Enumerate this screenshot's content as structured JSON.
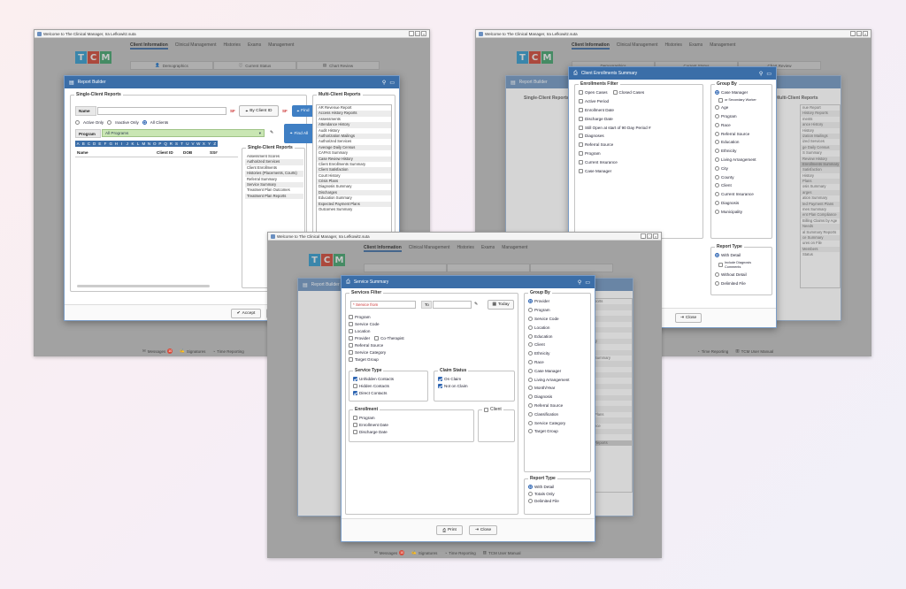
{
  "window_title": "Welcome to The Clinical Manager, Ira Lefkowitz.suta",
  "logo": [
    "T",
    "C",
    "M"
  ],
  "nav": [
    "Client Information",
    "Clinical Management",
    "Histories",
    "Exams",
    "Management"
  ],
  "subtabs": [
    "Demographics",
    "Current Status",
    "Chart Review"
  ],
  "bottom": {
    "messages": "Messages",
    "messages_count": "10",
    "signatures": "Signatures",
    "time_reporting": "Time Reporting",
    "user_manual": "TCM User Manual"
  },
  "report_builder": {
    "title": "Report Builder",
    "single_client": "Single-Client Reports",
    "multi_client": "Multi-Client Reports",
    "name_label": "Name",
    "by_client_id": "By Client ID",
    "find": "Find",
    "find_all": "Find All",
    "sf": "SF",
    "radios": [
      "Active Only",
      "Inactive Only",
      "All Clients"
    ],
    "program_label": "Program",
    "program_value": "All Programs",
    "alpha": [
      "A",
      "B",
      "C",
      "D",
      "E",
      "F",
      "G",
      "H",
      "I",
      "J",
      "K",
      "L",
      "M",
      "N",
      "O",
      "P",
      "Q",
      "R",
      "S",
      "T",
      "U",
      "V",
      "W",
      "X",
      "Y",
      "Z"
    ],
    "columns": [
      "Name",
      "Client ID",
      "DOB",
      "SS#"
    ],
    "single_list_title": "Single-Client Reports",
    "single_list": [
      "Assessment Scores",
      "Authorized Services",
      "Client Enrollments",
      "Histories (Placements, Courts)",
      "Referral Summary",
      "Service Summary",
      "Treatment Plan Outcomes",
      "Treatment Plan Reports"
    ],
    "multi_list": [
      "AR Revenue Report",
      "Access History Reports",
      "Assessments",
      "Attendance History",
      "Audit History",
      "Authorization Mailings",
      "Authorized Services",
      "Average Daily Census",
      "CAPAS Summary",
      "Case Review History",
      "Client Enrollments Summary",
      "Client Satisfaction",
      "Court History",
      "Crisis Plans",
      "Diagnosis Summary",
      "Discharges",
      "Education Summary",
      "Expected Payment Plans",
      "Outcomes Summary"
    ],
    "accept": "Accept",
    "close": "Close"
  },
  "enrollments": {
    "title": "Client Enrollments Summary",
    "filter_title": "Enrollments Filter",
    "filters": [
      "Open Cases",
      "Closed Cases",
      "Active Period",
      "Enrollment Date",
      "Discharge Date",
      "Still Open at start of 90 Day Period #",
      "Diagnoses",
      "Referral Source",
      "Program",
      "Current Insurance",
      "Case Manager"
    ],
    "group_title": "Group By",
    "group": [
      "Case Manager",
      "or Secondary Worker",
      "Age",
      "Program",
      "Race",
      "Referral Source",
      "Education",
      "Ethnicity",
      "Living Arrangement",
      "City",
      "County",
      "Client",
      "Current Insurance",
      "Diagnosis",
      "Municipality"
    ],
    "report_type_title": "Report Type",
    "report_types": [
      "With Detail",
      "Include Diagnosis Comments",
      "Without Detail",
      "Delimited File"
    ],
    "close": "Close",
    "bg_list": [
      "nue Report",
      "History Reports",
      "ments",
      "ance History",
      "History",
      "ization Mailings",
      "ized Services",
      "ge Daily Census",
      "S Summary",
      "Review History",
      "Enrollments Summary",
      "Satisfaction",
      "History",
      "Plans",
      "osis Summary",
      "arges",
      "ation Summary",
      "ted Payment Plans",
      "mes Summary",
      "ent Plan Compliance",
      "Billing Claims by Age",
      "Needs",
      "al Summary Reports",
      "ce Summary",
      "ures on File",
      "Members",
      "Status"
    ]
  },
  "service_summary": {
    "title": "Service Summary",
    "filter_title": "Services Filter",
    "service_from": "* Service from",
    "to": "To",
    "today": "Today",
    "filters": [
      "Program",
      "Service Code",
      "Location",
      "Provider",
      "Co-Therapist",
      "Referral Source",
      "Service Category",
      "Target Group"
    ],
    "service_type_title": "Service Type",
    "service_types": [
      "Unhidden Contacts",
      "Hidden Contacts",
      "Direct Contacts"
    ],
    "claim_status_title": "Claim Status",
    "claim_status": [
      "On Claim",
      "Not on Claim"
    ],
    "enrollment_title": "Enrollment",
    "enrollment": [
      "Program",
      "Enrollment Date",
      "Discharge Date"
    ],
    "client": "Client",
    "group_title": "Group By",
    "group": [
      "Provider",
      "Program",
      "Service Code",
      "Location",
      "Education",
      "Client",
      "Ethnicity",
      "Race",
      "Case Manager",
      "Living Arrangement",
      "Month/Year",
      "Diagnosis",
      "Referral Source",
      "Classification",
      "Service Category",
      "Target Group"
    ],
    "report_type_title": "Report Type",
    "report_types": [
      "With Detail",
      "Totals Only",
      "Delimited File"
    ],
    "print": "Print",
    "close": "Close",
    "bg_list": [
      "ports",
      "",
      "",
      "",
      "",
      "",
      "",
      "ly",
      "",
      "",
      "Summary",
      "",
      "",
      "",
      "",
      "",
      "",
      "",
      "",
      "",
      "Plans",
      "",
      "nce",
      "",
      "",
      "Reports",
      ""
    ]
  },
  "colors": {
    "accent": "#3b6ea8",
    "logo_t": "#2a9fd8",
    "logo_c": "#d9412e",
    "logo_m": "#3ba66b"
  }
}
